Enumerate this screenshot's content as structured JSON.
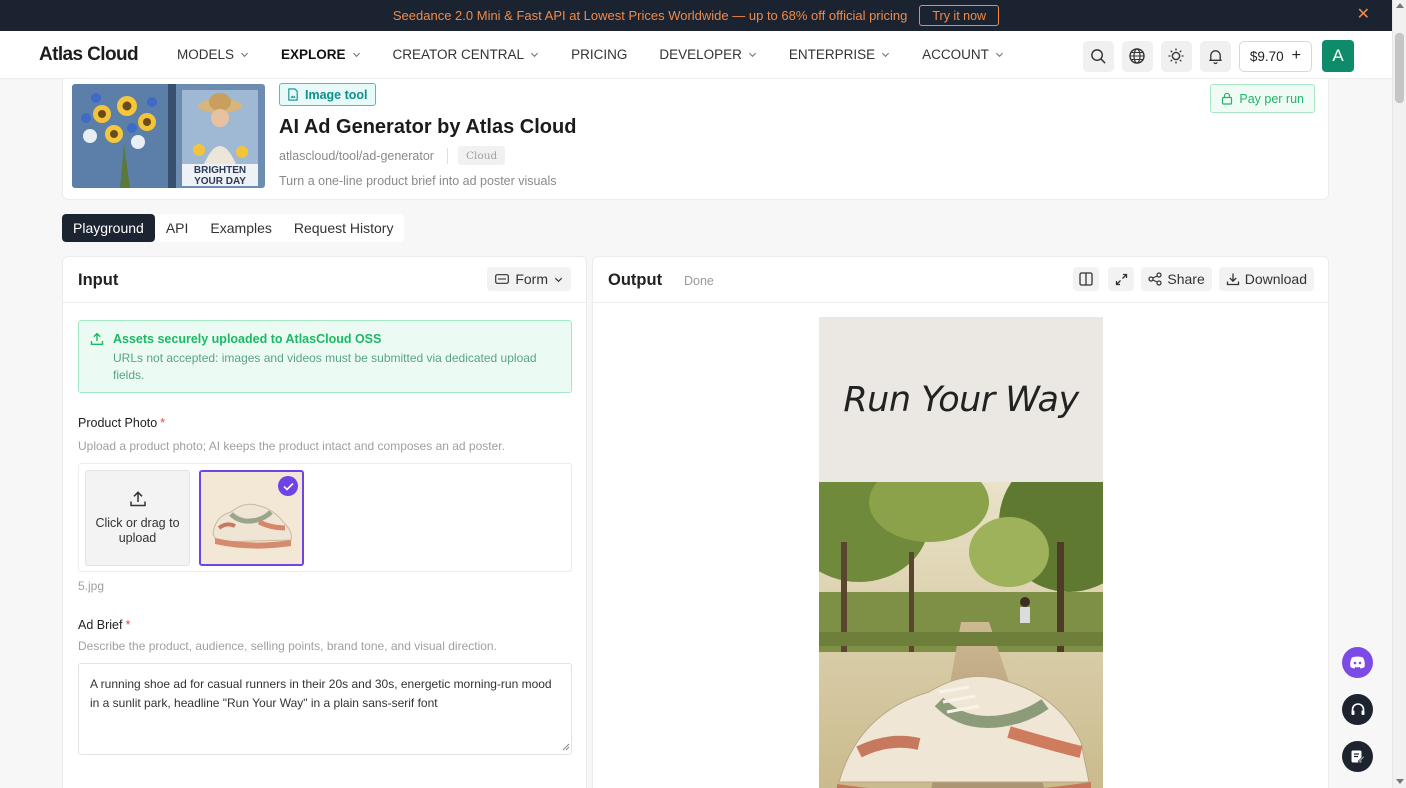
{
  "promo": {
    "text": "Seedance 2.0 Mini & Fast API at Lowest Prices Worldwide — up to 68% off official pricing",
    "cta": "Try it now",
    "close": "✕"
  },
  "nav": {
    "logo": "Atlas Cloud",
    "items": [
      {
        "label": "MODELS"
      },
      {
        "label": "EXPLORE"
      },
      {
        "label": "CREATOR CENTRAL"
      },
      {
        "label": "PRICING"
      },
      {
        "label": "DEVELOPER"
      },
      {
        "label": "ENTERPRISE"
      },
      {
        "label": "ACCOUNT"
      }
    ],
    "balance": "$9.70",
    "balance_plus": "+",
    "avatar": "A"
  },
  "tool": {
    "badge": "Image tool",
    "title": "AI Ad Generator by Atlas Cloud",
    "path": "atlascloud/tool/ad-generator",
    "provider_chip": "Cloud",
    "description": "Turn a one-line product brief into ad poster visuals",
    "pay_label": "Pay per run",
    "thumb_text_line1": "BRIGHTEN",
    "thumb_text_line2": "YOUR DAY"
  },
  "tabs": [
    {
      "label": "Playground"
    },
    {
      "label": "API"
    },
    {
      "label": "Examples"
    },
    {
      "label": "Request History"
    }
  ],
  "input": {
    "title": "Input",
    "mode": "Form",
    "notice_title": "Assets securely uploaded to AtlasCloud OSS",
    "notice_text": "URLs not accepted: images and videos must be submitted via dedicated upload fields.",
    "photo_label": "Product Photo",
    "photo_required": "*",
    "photo_hint": "Upload a product photo; AI keeps the product intact and composes an ad poster.",
    "upload_text": "Click or drag to upload",
    "filename": "5.jpg",
    "brief_label": "Ad Brief",
    "brief_required": "*",
    "brief_hint": "Describe the product, audience, selling points, brand tone, and visual direction.",
    "brief_value": "A running shoe ad for casual runners in their 20s and 30s, energetic morning-run mood in a sunlit park, headline \"Run Your Way\" in a plain sans-serif font"
  },
  "output": {
    "title": "Output",
    "status": "Done",
    "share": "Share",
    "download": "Download",
    "poster_headline": "Run Your Way"
  },
  "colors": {
    "accent_green": "#1cb864",
    "selected_purple": "#7043e6",
    "banner_bg": "#1b2330",
    "banner_text": "#f08a4b"
  }
}
